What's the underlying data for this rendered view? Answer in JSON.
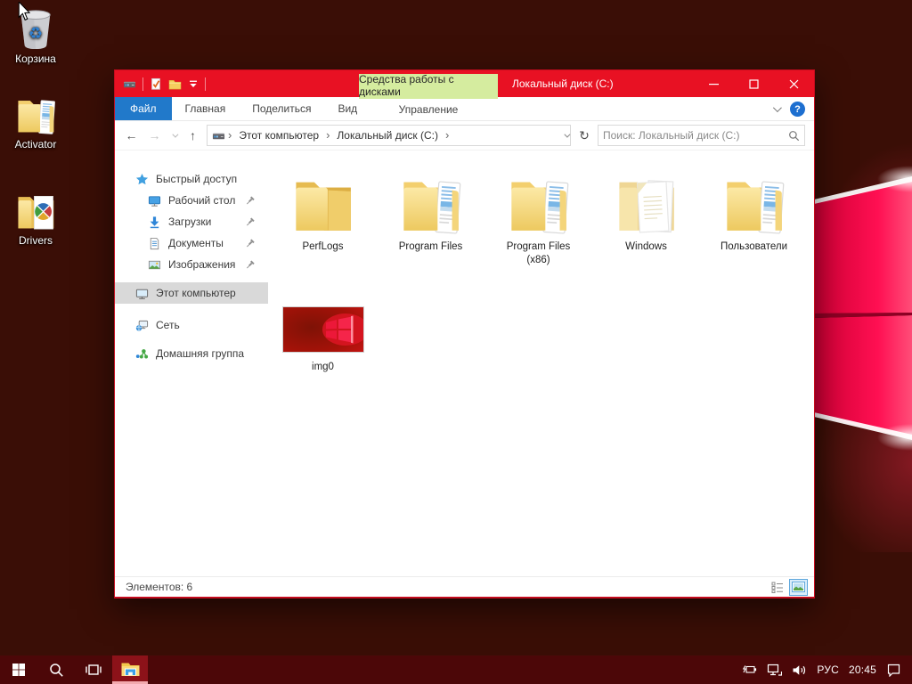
{
  "colors": {
    "accent_red": "#e81123",
    "file_tab_blue": "#2179ca",
    "contextual_green": "#d5ec9f",
    "selection_gray": "#d9d9d9"
  },
  "icons": {
    "back": "←",
    "forward": "→",
    "up": "↑",
    "refresh": "↻",
    "breadcrumb_sep": "›",
    "help": "?"
  },
  "desktop": {
    "icons": [
      {
        "label": "Корзина"
      },
      {
        "label": "Activator"
      },
      {
        "label": "Drivers"
      }
    ]
  },
  "window": {
    "title": "Локальный диск (C:)",
    "contextual_tab": "Средства работы с дисками",
    "tabs": [
      {
        "label": "Файл"
      },
      {
        "label": "Главная"
      },
      {
        "label": "Поделиться"
      },
      {
        "label": "Вид"
      },
      {
        "label": "Управление"
      }
    ],
    "address": {
      "breadcrumbs": [
        {
          "label": "Этот компьютер"
        },
        {
          "label": "Локальный диск (C:)"
        }
      ],
      "search_placeholder": "Поиск: Локальный диск (C:)"
    },
    "sidebar": {
      "items": [
        {
          "label": "Быстрый доступ"
        },
        {
          "label": "Рабочий стол"
        },
        {
          "label": "Загрузки"
        },
        {
          "label": "Документы"
        },
        {
          "label": "Изображения"
        },
        {
          "label": "Этот компьютер"
        },
        {
          "label": "Сеть"
        },
        {
          "label": "Домашняя группа"
        }
      ]
    },
    "content": {
      "items": [
        {
          "label": "PerfLogs"
        },
        {
          "label": "Program Files"
        },
        {
          "label": "Program Files (x86)"
        },
        {
          "label": "Windows"
        },
        {
          "label": "Пользователи"
        },
        {
          "label": "img0"
        }
      ]
    },
    "status": {
      "count": "Элементов: 6"
    }
  },
  "taskbar": {
    "language": "РУС",
    "time": "20:45"
  }
}
